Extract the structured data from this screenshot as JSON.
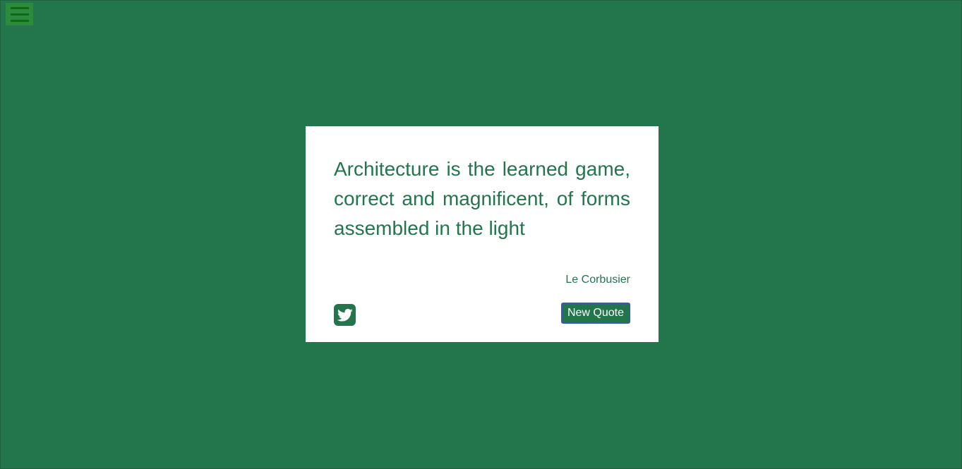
{
  "menu": {
    "icon": "hamburger-menu-icon"
  },
  "quote": {
    "text": "Architecture is the learned game, correct and magnificent, of forms assembled in the light",
    "author": "Le Corbusier"
  },
  "actions": {
    "tweet_icon": "twitter-icon",
    "new_quote_label": "New Quote"
  },
  "colors": {
    "background": "#23754c",
    "card": "#ffffff",
    "accent": "#23754c",
    "menu_button": "#2c8a3f",
    "menu_bars": "#0e6a12",
    "focus_ring": "#3a56b8"
  }
}
